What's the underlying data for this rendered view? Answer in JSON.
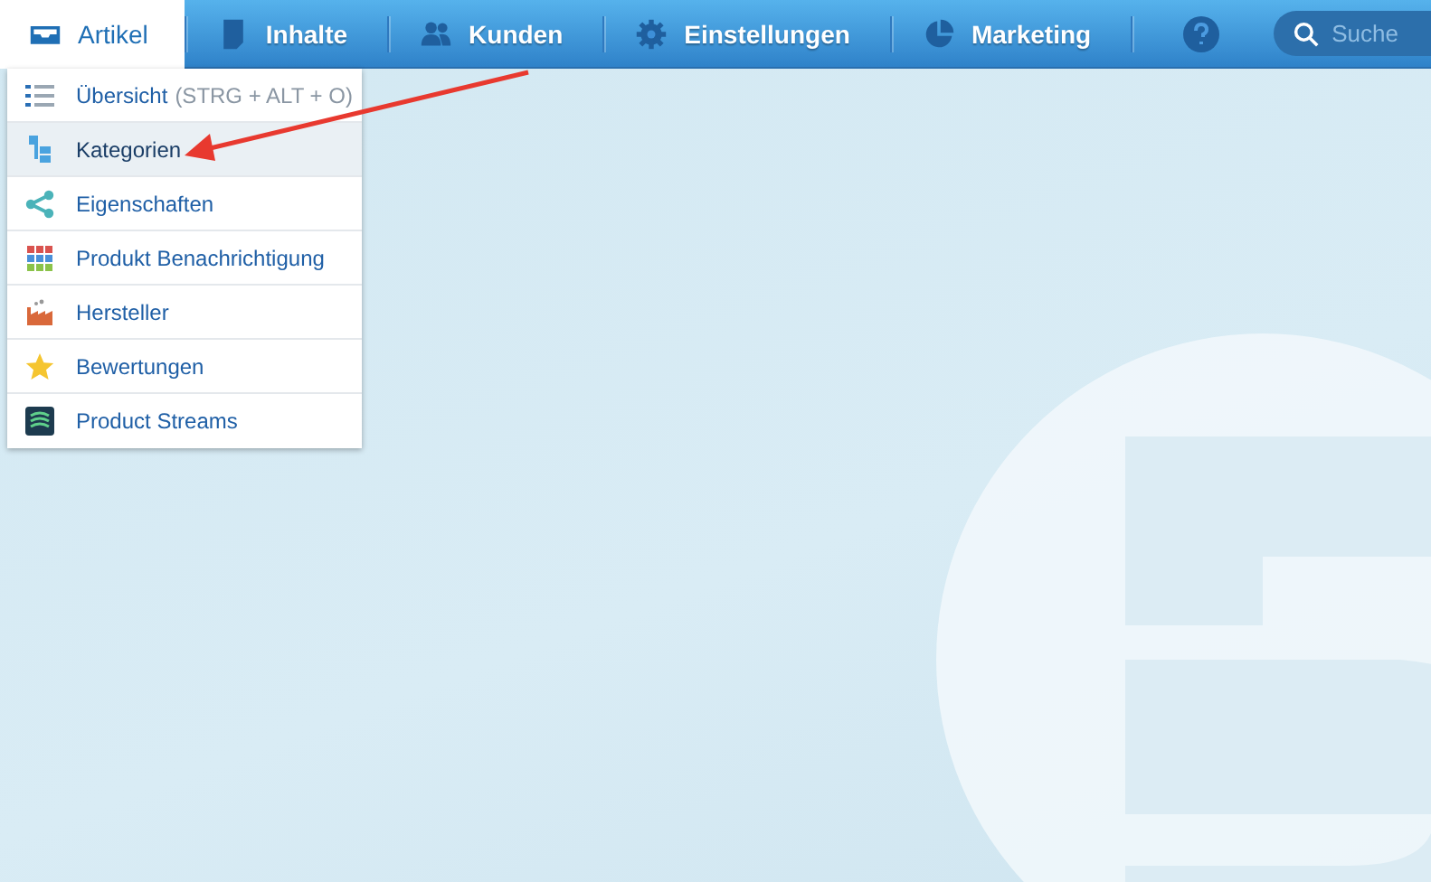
{
  "nav": {
    "items": [
      {
        "label": "Artikel",
        "selected": true
      },
      {
        "label": "Inhalte",
        "selected": false
      },
      {
        "label": "Kunden",
        "selected": false
      },
      {
        "label": "Einstellungen",
        "selected": false
      },
      {
        "label": "Marketing",
        "selected": false
      }
    ],
    "search": {
      "placeholder": "Suche"
    }
  },
  "menu": {
    "items": [
      {
        "label": "Übersicht",
        "shortcut": "(STRG + ALT + O)",
        "selected": false
      },
      {
        "label": "Kategorien",
        "selected": true
      },
      {
        "label": "Eigenschaften",
        "selected": false
      },
      {
        "label": "Produkt Benachrichtigung",
        "selected": false
      },
      {
        "label": "Hersteller",
        "selected": false
      },
      {
        "label": "Bewertungen",
        "selected": false
      },
      {
        "label": "Product Streams",
        "selected": false
      }
    ]
  }
}
